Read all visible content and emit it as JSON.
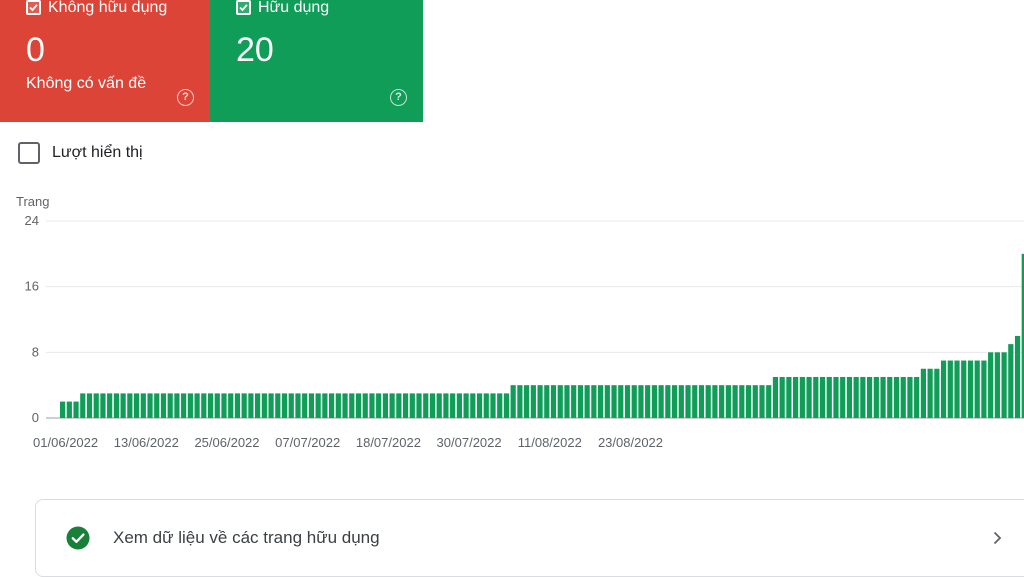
{
  "cards": {
    "not_useful": {
      "title": "Không hữu dụng",
      "value": "0",
      "subtitle": "Không có vấn đề",
      "checked": true,
      "color": "#db4437"
    },
    "useful": {
      "title": "Hữu dụng",
      "value": "20",
      "checked": true,
      "color": "#0f9d58"
    }
  },
  "impressions_toggle": {
    "label": "Lượt hiển thị",
    "checked": false
  },
  "view_data": {
    "label": "Xem dữ liệu về các trang hữu dụng"
  },
  "chart_data": {
    "type": "bar",
    "ylabel": "Trang",
    "ylim": [
      0,
      24
    ],
    "yticks": [
      "24",
      "16",
      "8",
      "0"
    ],
    "x_tick_labels": [
      "01/06/2022",
      "13/06/2022",
      "25/06/2022",
      "07/07/2022",
      "18/07/2022",
      "30/07/2022",
      "11/08/2022",
      "23/08/2022"
    ],
    "x_start": "01/06/2022",
    "values": [
      2,
      2,
      2,
      3,
      3,
      3,
      3,
      3,
      3,
      3,
      3,
      3,
      3,
      3,
      3,
      3,
      3,
      3,
      3,
      3,
      3,
      3,
      3,
      3,
      3,
      3,
      3,
      3,
      3,
      3,
      3,
      3,
      3,
      3,
      3,
      3,
      3,
      3,
      3,
      3,
      3,
      3,
      3,
      3,
      3,
      3,
      3,
      3,
      3,
      3,
      3,
      3,
      3,
      3,
      3,
      3,
      3,
      3,
      3,
      3,
      3,
      3,
      3,
      3,
      3,
      3,
      3,
      4,
      4,
      4,
      4,
      4,
      4,
      4,
      4,
      4,
      4,
      4,
      4,
      4,
      4,
      4,
      4,
      4,
      4,
      4,
      4,
      4,
      4,
      4,
      4,
      4,
      4,
      4,
      4,
      4,
      4,
      4,
      4,
      4,
      4,
      4,
      4,
      4,
      4,
      4,
      5,
      5,
      5,
      5,
      5,
      5,
      5,
      5,
      5,
      5,
      5,
      5,
      5,
      5,
      5,
      5,
      5,
      5,
      5,
      5,
      5,
      5,
      6,
      6,
      6,
      7,
      7,
      7,
      7,
      7,
      7,
      7,
      8,
      8,
      8,
      9,
      10,
      20
    ],
    "bar_color": "#0f9d58",
    "grid": true
  }
}
